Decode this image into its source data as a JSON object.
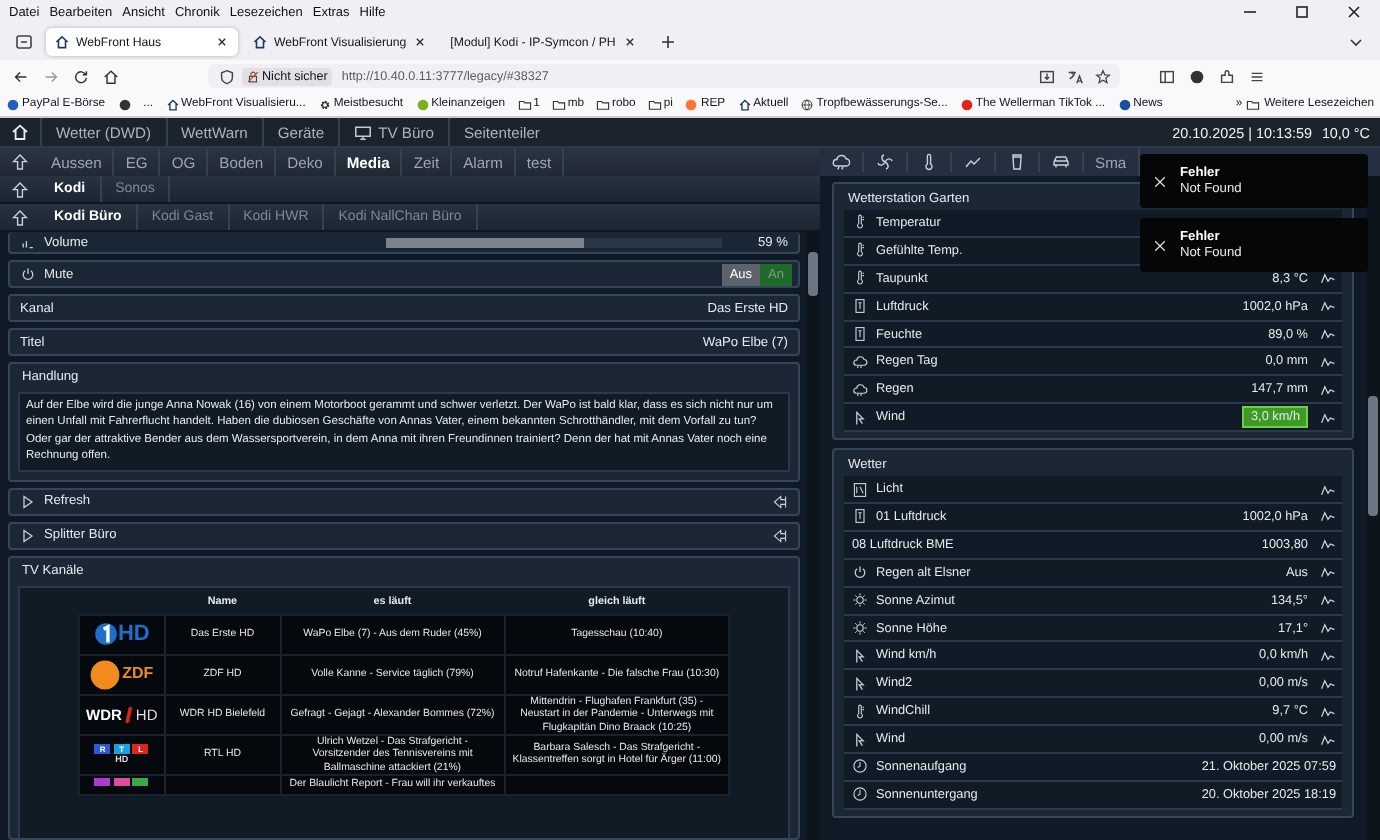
{
  "browser": {
    "menu": [
      "Datei",
      "Bearbeiten",
      "Ansicht",
      "Chronik",
      "Lesezeichen",
      "Extras",
      "Hilfe"
    ],
    "tabs": [
      {
        "title": "WebFront Haus",
        "selected": true,
        "favicon": true
      },
      {
        "title": "WebFront Visualisierung",
        "selected": false,
        "favicon": true
      },
      {
        "title": "[Modul] Kodi - IP-Symcon / PH",
        "selected": false,
        "favicon": false
      }
    ],
    "security": "Nicht sicher",
    "url": "http://10.40.0.11:3777/legacy/#38327",
    "bookmarks": [
      {
        "kind": "site",
        "label": "PayPal E-Börse",
        "color": "#1f5fbf"
      },
      {
        "kind": "site",
        "color": "#333333"
      },
      {
        "kind": "text",
        "label": "..."
      },
      {
        "kind": "home",
        "label": "WebFront Visualisieru..."
      },
      {
        "kind": "gear",
        "label": "Meistbesucht"
      },
      {
        "kind": "site",
        "label": "Kleinanzeigen",
        "color": "#7ab317"
      },
      {
        "kind": "folder",
        "label": "1"
      },
      {
        "kind": "folder",
        "label": "mb"
      },
      {
        "kind": "folder",
        "label": "robo"
      },
      {
        "kind": "folder",
        "label": "pi"
      },
      {
        "kind": "site",
        "label": "REP",
        "color": "#ff7139"
      },
      {
        "kind": "home",
        "label": "Aktuell"
      },
      {
        "kind": "globe",
        "label": "Tropfbewässerungs-Se..."
      },
      {
        "kind": "site",
        "label": "The Wellerman TikTok ...",
        "color": "#e62117"
      },
      {
        "kind": "site",
        "label": "News",
        "color": "#1a4fa0"
      }
    ],
    "more": "»",
    "other_bookmarks": "Weitere Lesezeichen"
  },
  "webfront": {
    "top_nav": [
      {
        "label": "Wetter (DWD)",
        "kind": "plain"
      },
      {
        "label": "WettWarn",
        "kind": "plain"
      },
      {
        "label": "Geräte",
        "kind": "plain"
      },
      {
        "label": "TV Büro",
        "kind": "monitor"
      },
      {
        "label": "Seitenteiler",
        "kind": "plain"
      }
    ],
    "datetime": "20.10.2025 | 10:13:59",
    "temperature": "10,0 °C",
    "sub_nav": [
      {
        "label": "Aussen",
        "selected": false
      },
      {
        "label": "EG",
        "selected": false
      },
      {
        "label": "OG",
        "selected": false
      },
      {
        "label": "Boden",
        "selected": false
      },
      {
        "label": "Deko",
        "selected": false
      },
      {
        "label": "Media",
        "selected": true
      },
      {
        "label": "Zeit",
        "selected": false
      },
      {
        "label": "Alarm",
        "selected": false
      },
      {
        "label": "test",
        "selected": false
      }
    ],
    "right_nav_label": "Sma",
    "left": {
      "tabs1": [
        {
          "label": "Kodi",
          "selected": true
        },
        {
          "label": "Sonos",
          "selected": false
        }
      ],
      "tabs2": [
        {
          "label": "Kodi Büro",
          "selected": true
        },
        {
          "label": "Kodi Gast",
          "selected": false
        },
        {
          "label": "Kodi HWR",
          "selected": false
        },
        {
          "label": "Kodi NallChan Büro",
          "selected": false
        }
      ],
      "volume": {
        "label": "Volume",
        "level": 0.59,
        "reading": "59 %"
      },
      "mute": {
        "label": "Mute",
        "options": [
          {
            "label": "Aus",
            "selected": true,
            "color": "#5d636b"
          },
          {
            "label": "An",
            "selected": false,
            "color": "#1e6b2c"
          }
        ]
      },
      "fields": [
        {
          "label": "Kanal",
          "value": "Das Erste HD"
        },
        {
          "label": "Titel",
          "value": "WaPo Elbe (7)"
        }
      ],
      "plot": {
        "label": "Handlung",
        "text": "Auf der Elbe wird die junge Anna Nowak (16) von einem Motorboot gerammt und schwer verletzt. Der WaPo ist bald klar, dass es sich nicht nur um einen Unfall mit Fahrerflucht handelt. Haben die dubiosen Geschäfte von Annas Vater, einem bekannten Schrotthändler, mit dem Vorfall zu tun? Oder gar der attraktive Bender aus dem Wassersportverein, in dem Anna mit ihren Freundinnen trainiert? Denn der hat mit Annas Vater noch eine Rechnung offen."
      },
      "scripts": [
        {
          "label": "Refresh"
        },
        {
          "label": "Splitter Büro"
        }
      ],
      "tv": {
        "title": "TV Kanäle",
        "columns": [
          "Name",
          "es läuft",
          "gleich läuft"
        ],
        "rows": [
          {
            "logo": {
              "kind": "ard",
              "texts": [
                "HD"
              ]
            },
            "name": "Das Erste HD",
            "now": "WaPo Elbe (7) - Aus dem Ruder (45%)",
            "next": "Tagesschau (10:40)"
          },
          {
            "logo": {
              "kind": "zdf",
              "texts": [
                "ZDF"
              ]
            },
            "name": "ZDF HD",
            "now": "Volle Kanne - Service täglich (79%)",
            "next": "Notruf Hafenkante - Die falsche Frau (10:30)"
          },
          {
            "logo": {
              "kind": "wdr",
              "texts": [
                "WDR",
                "HD"
              ]
            },
            "name": "WDR HD Bielefeld",
            "now": "Gefragt - Gejagt - Alexander Bommes (72%)",
            "next": "Mittendrin - Flughafen Frankfurt (35) - Neustart in der Pandemie - Unterwegs mit Flugkapitän Dino Braack (10:25)"
          },
          {
            "logo": {
              "kind": "rtl",
              "texts": [
                "HD"
              ],
              "blocks": [
                {
                  "text": "R",
                  "color": "#2a5bd7"
                },
                {
                  "text": "T",
                  "color": "#16a3e0"
                },
                {
                  "text": "L",
                  "color": "#e2231a"
                }
              ]
            },
            "name": "RTL HD",
            "now": "Ulrich Wetzel - Das Strafgericht - Vorsitzender des Tennisvereins mit Ballmaschine attackiert (21%)",
            "next": "Barbara Salesch - Das Strafgericht - Klassentreffen sorgt in Hotel für Ärger (11:00)"
          },
          {
            "logo": {
              "kind": "blocks",
              "blocks": [
                {
                  "color": "#b03ad0"
                },
                {
                  "color": "#e04aa0"
                },
                {
                  "color": "#3aa84a"
                }
              ]
            },
            "now": "Der Blaulicht Report - Frau will ihr verkauftes"
          }
        ]
      }
    },
    "right": {
      "panels": [
        {
          "title": "Wetterstation Garten",
          "rows": [
            {
              "kind": "thermometer",
              "label": "Temperatur",
              "graph": false
            },
            {
              "kind": "thermometer",
              "label": "Gefühlte Temp.",
              "graph": false
            },
            {
              "kind": "thermometer",
              "label": "Taupunkt",
              "value": "8,3 °C",
              "graph": true,
              "highlighted": false
            },
            {
              "kind": "gauge",
              "label": "Luftdruck",
              "value": "1002,0 hPa",
              "graph": true,
              "highlighted": false
            },
            {
              "kind": "gauge",
              "label": "Feuchte",
              "value": "89,0 %",
              "graph": true,
              "highlighted": false
            },
            {
              "kind": "cloud",
              "label": "Regen Tag",
              "value": "0,0 mm",
              "graph": true,
              "highlighted": false
            },
            {
              "kind": "cloud",
              "label": "Regen",
              "value": "147,7 mm",
              "graph": true,
              "highlighted": false
            },
            {
              "kind": "wind",
              "label": "Wind",
              "value": "3,0 km/h",
              "graph": true,
              "highlighted": true
            }
          ]
        },
        {
          "title": "Wetter",
          "rows": [
            {
              "kind": "light",
              "label": "Licht",
              "graph": true
            },
            {
              "kind": "gauge",
              "label": "01 Luftdruck",
              "value": "1002,0 hPa",
              "graph": true,
              "highlighted": false
            },
            {
              "kind": "none",
              "label": "08 Luftdruck BME",
              "value": "1003,80",
              "graph": true,
              "highlighted": false
            },
            {
              "kind": "power",
              "label": "Regen alt Elsner",
              "value": "Aus",
              "graph": true,
              "highlighted": false
            },
            {
              "kind": "sun",
              "label": "Sonne Azimut",
              "value": "134,5°",
              "graph": true,
              "highlighted": false
            },
            {
              "kind": "sun",
              "label": "Sonne Höhe",
              "value": "17,1°",
              "graph": true,
              "highlighted": false
            },
            {
              "kind": "wind",
              "label": "Wind km/h",
              "value": "0,0 km/h",
              "graph": true,
              "highlighted": false
            },
            {
              "kind": "wind",
              "label": "Wind2",
              "value": "0,00 m/s",
              "graph": true,
              "highlighted": false
            },
            {
              "kind": "thermometer",
              "label": "WindChill",
              "value": "9,7 °C",
              "graph": true,
              "highlighted": false
            },
            {
              "kind": "wind",
              "label": "Wind",
              "value": "0,00 m/s",
              "graph": true,
              "highlighted": false
            },
            {
              "kind": "clock",
              "label": "Sonnenaufgang",
              "value": "21. Oktober 2025 07:59",
              "graph": false,
              "highlighted": false
            },
            {
              "kind": "clock",
              "label": "Sonnenuntergang",
              "value": "20. Oktober 2025 18:19",
              "graph": false,
              "highlighted": false
            }
          ]
        }
      ]
    },
    "toasts": [
      {
        "title": "Fehler",
        "message": "Not Found"
      },
      {
        "title": "Fehler",
        "message": "Not Found"
      }
    ]
  }
}
